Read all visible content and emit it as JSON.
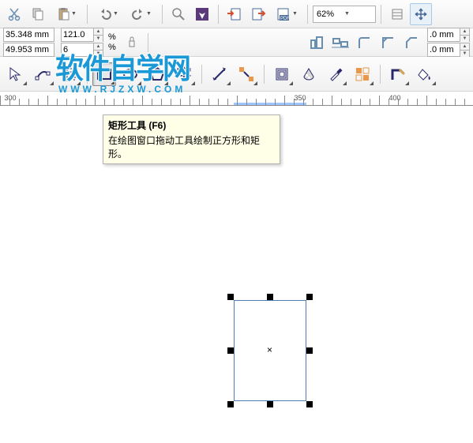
{
  "row1": {
    "zoom": "62%"
  },
  "row2": {
    "x": "35.348 mm",
    "y": "49.953 mm",
    "w": "121.0",
    "h": "6",
    "pct": "%",
    "outline1": ".0 mm",
    "outline2": ".0 mm"
  },
  "tooltip": {
    "title": "矩形工具 (F6)",
    "desc": "在绘图窗口拖动工具绘制正方形和矩形。"
  },
  "ruler": {
    "marks": [
      "300",
      "350",
      "400"
    ]
  },
  "watermark": {
    "main": "软件自学网",
    "sub": "WWW.RJZXW.COM"
  }
}
